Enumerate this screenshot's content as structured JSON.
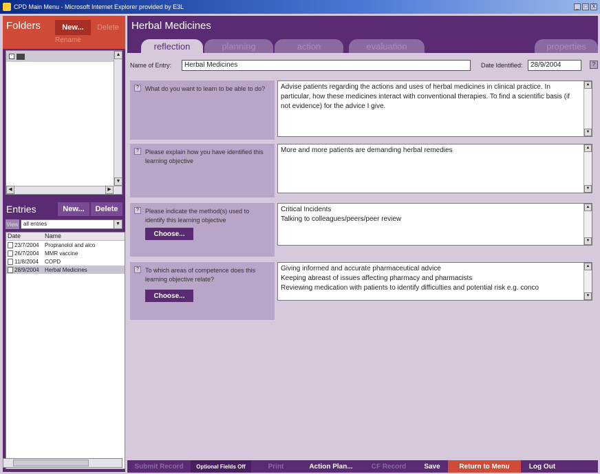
{
  "window": {
    "title": "CPD Main Menu - Microsoft Internet Explorer provided by E3L",
    "controls": [
      "_",
      "□",
      "X"
    ]
  },
  "folders": {
    "title": "Folders",
    "new_label": "New...",
    "delete_label": "Delete",
    "rename_label": "Rename"
  },
  "entries": {
    "title": "Entries",
    "new_label": "New...",
    "delete_label": "Delete",
    "view_label": "View",
    "filter_value": "all entries",
    "columns": [
      "Date",
      "Name"
    ],
    "rows": [
      {
        "date": "23/7/2004",
        "name": "Propranolol and alco"
      },
      {
        "date": "26/7/2004",
        "name": "MMR vaccine"
      },
      {
        "date": "11/8/2004",
        "name": "COPD"
      },
      {
        "date": "28/9/2004",
        "name": "Herbal Medicines"
      }
    ]
  },
  "main": {
    "title": "Herbal Medicines",
    "tabs": [
      {
        "label": "reflection"
      },
      {
        "label": "planning"
      },
      {
        "label": "action"
      },
      {
        "label": "evaluation"
      },
      {
        "label": "properties"
      }
    ],
    "name_label": "Name of Entry:",
    "name_value": "Herbal Medicines",
    "date_label": "Date Identified:",
    "date_value": "28/9/2004",
    "help_glyph": "?",
    "questions": [
      {
        "q": "What do you want to learn to be able to do?",
        "answer": "Advise patients regarding the actions and uses of herbal medicines in clinical practice. In particular, how these medicines interact with conventional therapies. To find a scientific basis (if not evidence) for the advice I give."
      },
      {
        "q": "Please explain how you have identified this learning objective",
        "answer": "More and more patients are demanding herbal remedies"
      },
      {
        "q": "Please indicate the method(s) used to identify this learning objective",
        "choose": "Choose...",
        "answer_lines": [
          "Critical Incidents",
          "Talking to colleagues/peers/peer review"
        ]
      },
      {
        "q": "To which areas of competence does this learning objective relate?",
        "choose": "Choose...",
        "answer_lines": [
          "Giving informed and accurate pharmaceutical advice",
          "Keeping abreast of issues affecting pharmacy and pharmacists",
          "Reviewing medication with patients to identify difficulties and potential risk e.g. conco"
        ]
      }
    ]
  },
  "bottom_bar": {
    "submit": "Submit Record",
    "optional": "Optional Fields Off",
    "print": "Print",
    "action_plan": "Action Plan...",
    "cf_record": "CF Record",
    "save": "Save",
    "return": "Return to Menu",
    "logout": "Log Out"
  }
}
